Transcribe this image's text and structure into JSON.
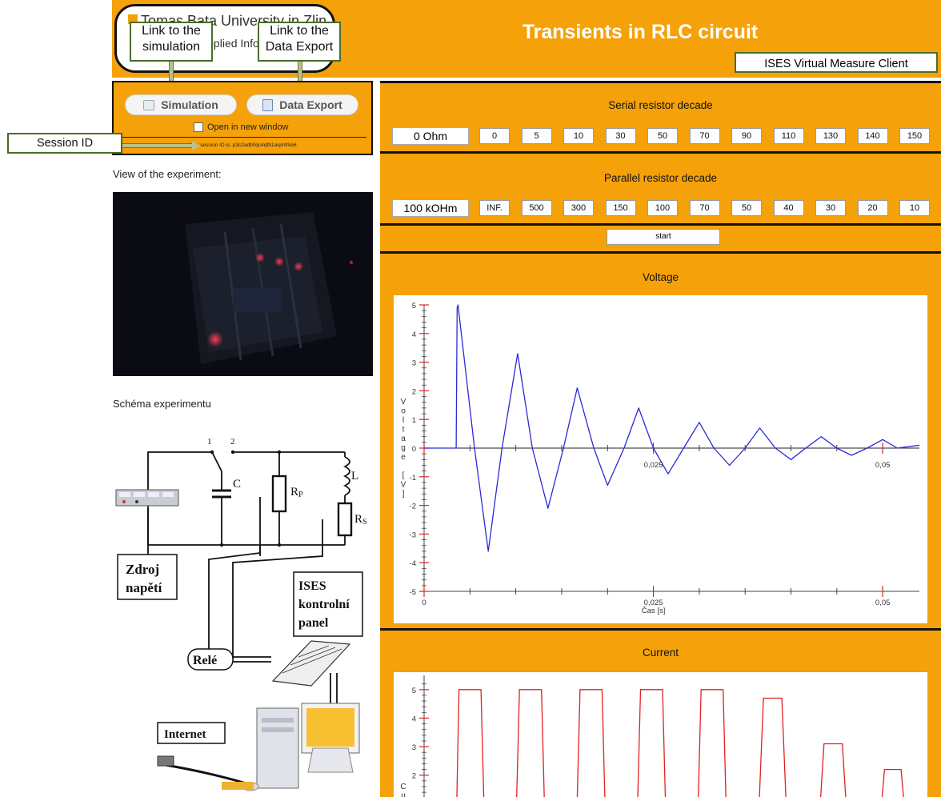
{
  "header": {
    "title": "Transients in RLC circuit",
    "client_label": "ISES Virtual Measure Client",
    "logo_line1": "Tomas Bata University in Zlin",
    "logo_line2": "Faculty of Applied Informatics"
  },
  "callouts": {
    "simulation": "Link to the simulation",
    "data_export": "Link to the Data Export",
    "session_id": "Session ID"
  },
  "left_panel": {
    "simulation_label": "Simulation",
    "data_export_label": "Data Export",
    "open_new_window": "Open in new window",
    "session_text": "Your session ID is: p3c2adb0qc4qfb1asjmfrke6"
  },
  "view_label": "View of the experiment:",
  "schema": {
    "label": "Schéma experimentu",
    "switch_1": "1",
    "switch_2": "2",
    "c": "C",
    "rp": "R",
    "rp_sub": "P",
    "l": "L",
    "rs": "R",
    "rs_sub": "S",
    "zdroj1": "Zdroj",
    "zdroj2": "napětí",
    "ises1": "ISES",
    "ises2": "kontrolní",
    "ises3": "panel",
    "rele": "Relé",
    "internet": "Internet"
  },
  "serial": {
    "title": "Serial resistor decade",
    "value": "0 Ohm",
    "options": [
      "0",
      "5",
      "10",
      "30",
      "50",
      "70",
      "90",
      "110",
      "130",
      "140",
      "150"
    ]
  },
  "parallel": {
    "title": "Parallel resistor decade",
    "value": "100 kOHm",
    "options": [
      "INF.",
      "500",
      "300",
      "150",
      "100",
      "70",
      "50",
      "40",
      "30",
      "20",
      "10"
    ]
  },
  "start_label": "start",
  "voltage_title": "Voltage",
  "current_title": "Current",
  "chart_data": [
    {
      "type": "line",
      "title": "Voltage",
      "xlabel": "Čas [s]",
      "ylabel": "Voltage [V]",
      "xlim": [
        0,
        0.054
      ],
      "ylim": [
        -5,
        5
      ],
      "x_ticks": [
        "0",
        "0,025",
        "0,05"
      ],
      "y_ticks": [
        "5",
        "4",
        "3",
        "2",
        "1",
        "0",
        "-1",
        "-2",
        "-3",
        "-4",
        "-5"
      ],
      "color": "#2a2ad8",
      "series": [
        {
          "x": [
            0,
            0.0035,
            0.0036,
            0.0037,
            0.0055,
            0.007,
            0.0085,
            0.0102,
            0.0118,
            0.0135,
            0.0152,
            0.0167,
            0.0185,
            0.02,
            0.0218,
            0.0234,
            0.025,
            0.0266,
            0.0283,
            0.03,
            0.0316,
            0.0333,
            0.035,
            0.0366,
            0.0383,
            0.04,
            0.0416,
            0.0433,
            0.045,
            0.0466,
            0.0483,
            0.05,
            0.0516,
            0.054
          ],
          "values": [
            0,
            0,
            4.9,
            5.0,
            0,
            -3.6,
            0,
            3.3,
            0,
            -2.1,
            0,
            2.1,
            0,
            -1.3,
            0,
            1.4,
            0,
            -0.9,
            0,
            0.9,
            0,
            -0.6,
            0,
            0.7,
            0,
            -0.4,
            0,
            0.4,
            0,
            -0.25,
            0,
            0.3,
            0,
            0.1
          ]
        }
      ]
    },
    {
      "type": "line",
      "title": "Current",
      "xlabel": "",
      "ylabel": "Cu...",
      "xlim": [
        0,
        0.054
      ],
      "ylim": [
        0,
        5.5
      ],
      "y_ticks": [
        "5",
        "4",
        "3",
        "2"
      ],
      "color": "#e02020",
      "series": [
        {
          "x": [
            0.0035,
            0.0038,
            0.0062,
            0.0066,
            0.01,
            0.0104,
            0.0128,
            0.0132,
            0.0166,
            0.017,
            0.0194,
            0.0198,
            0.0232,
            0.0236,
            0.026,
            0.0264,
            0.0298,
            0.0302,
            0.0326,
            0.033,
            0.0364,
            0.037,
            0.039,
            0.0396,
            0.043,
            0.0436,
            0.0456,
            0.0462,
            0.0496,
            0.0502,
            0.052,
            0.0526
          ],
          "values": [
            0,
            5,
            5,
            0,
            0,
            5,
            5,
            0,
            0,
            5,
            5,
            0,
            0,
            5,
            5,
            0,
            0,
            5,
            5,
            0,
            0,
            4.7,
            4.7,
            0,
            0,
            3.1,
            3.1,
            0,
            0,
            2.2,
            2.2,
            0
          ]
        }
      ]
    }
  ]
}
